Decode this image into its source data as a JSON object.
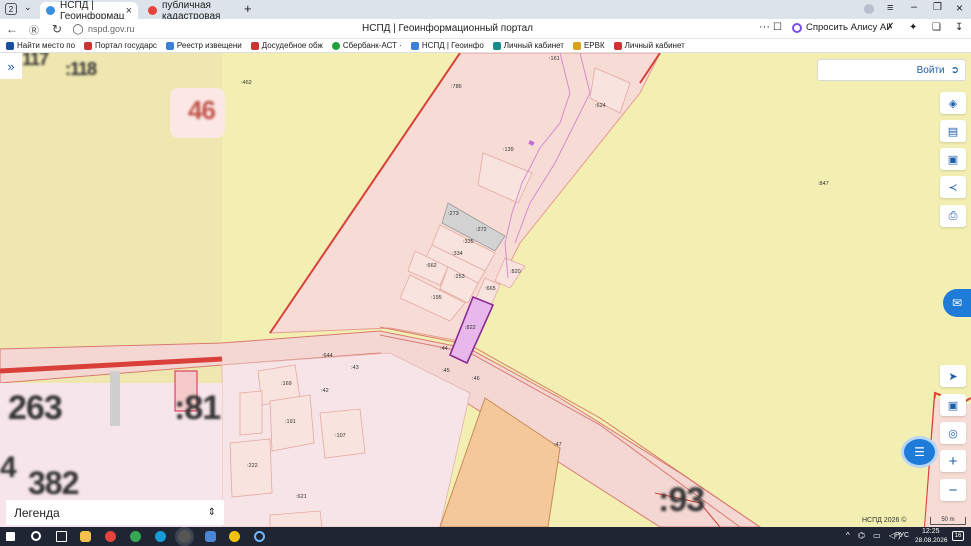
{
  "browser": {
    "tab_counter": "2",
    "tabs": [
      {
        "label": "НСПД | Геоинформац",
        "active": true
      },
      {
        "label": "публичная кадастровая"
      }
    ],
    "url": "nspd.gov.ru",
    "page_title": "НСПД | Геоинформационный портал",
    "alice_label": "Спросить Алису AI",
    "bookmarks": [
      "Найти место по",
      "Портал государс",
      "Реестр извещени",
      "Досудебное обж",
      "Сбербанк-АСТ ·",
      "НСПД | Геоинфо",
      "Личный кабинет",
      "ЕРВК",
      "Личный кабинет"
    ]
  },
  "map": {
    "login_label": "Войти",
    "legend_label": "Легенда",
    "copyright": "НСПД 2026 ©",
    "scale": "50 m",
    "parcels": [
      ":161",
      ":786",
      ":624",
      ":462",
      ":139",
      ":273",
      ":272",
      ":335",
      ":334",
      ":662",
      ":253",
      ":820",
      ":665",
      ":195",
      ":847",
      ":822",
      ":44",
      ":45",
      ":46",
      ":644",
      ":43",
      ":169",
      ":42",
      ":191",
      ":107",
      ":222",
      ":47",
      ":621"
    ],
    "blocks": [
      "117",
      ":118",
      "46",
      "263",
      ":81",
      "382",
      ":93",
      "4"
    ]
  },
  "taskbar": {
    "time": "12:25",
    "date": "28.08.2026",
    "lang": "РУС",
    "badge": "16"
  }
}
